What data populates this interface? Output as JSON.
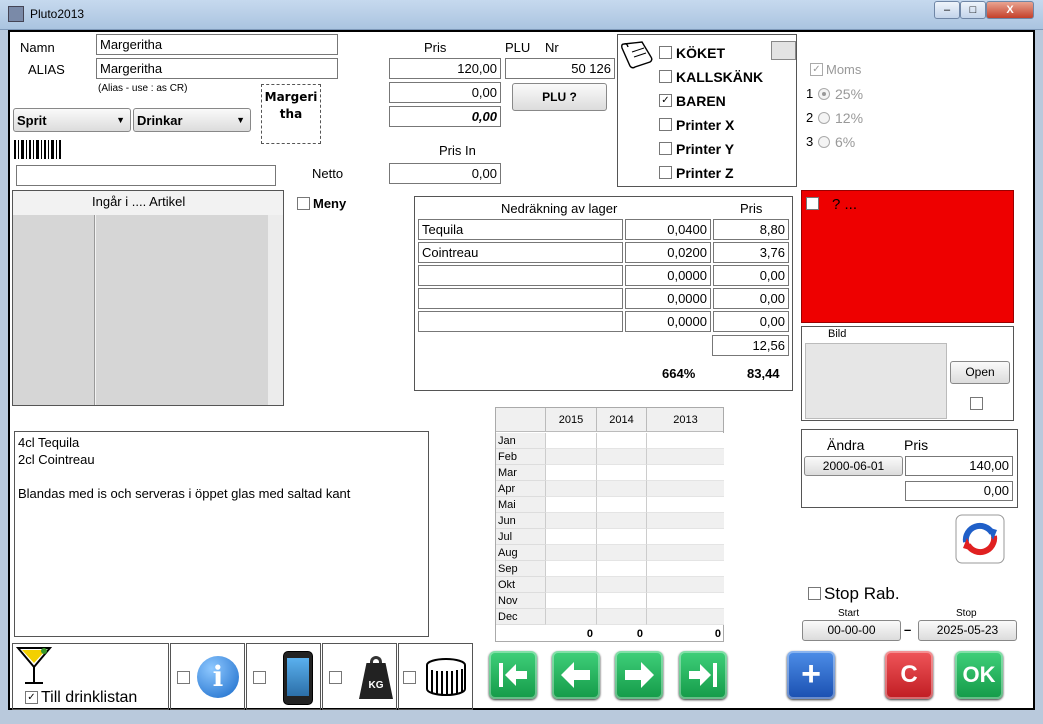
{
  "window": {
    "title": "Pluto2013",
    "minimize": "–",
    "maximize": "□",
    "close": "X"
  },
  "article": {
    "namn_label": "Namn",
    "namn_value": "Margeritha",
    "alias_label": "ALIAS",
    "alias_value": "Margeritha",
    "alias_hint": "(Alias - use : as CR)",
    "button_label_line1": "Margeri",
    "button_label_line2": "tha",
    "category1": "Sprit",
    "category2": "Drinkar",
    "barcode_value": ""
  },
  "pricing": {
    "pris_label": "Pris",
    "plu_label": "PLU",
    "nr_label": "Nr",
    "pris_value": "120,00",
    "plu_value": "50 126",
    "pris2": "0,00",
    "pris3": "0,00",
    "plu_button": "PLU ?",
    "pris_in_label": "Pris In",
    "netto_label": "Netto",
    "netto_value": "0,00"
  },
  "printers": [
    {
      "label": "KÖKET",
      "checked": false
    },
    {
      "label": "KALLSKÄNK",
      "checked": false
    },
    {
      "label": "BAREN",
      "checked": true
    },
    {
      "label": "Printer X",
      "checked": false
    },
    {
      "label": "Printer Y",
      "checked": false
    },
    {
      "label": "Printer Z",
      "checked": false
    }
  ],
  "moms": {
    "label": "Moms",
    "options": [
      {
        "num": "1",
        "rate": "25%",
        "selected": true
      },
      {
        "num": "2",
        "rate": "12%",
        "selected": false
      },
      {
        "num": "3",
        "rate": "6%",
        "selected": false
      }
    ]
  },
  "ingar": {
    "header": "Ingår i ....  Artikel",
    "meny_label": "Meny"
  },
  "lager": {
    "title": "Nedräkning av lager",
    "pris_header": "Pris",
    "rows": [
      {
        "name": "Tequila",
        "qty": "0,0400",
        "price": "8,80"
      },
      {
        "name": "Cointreau",
        "qty": "0,0200",
        "price": "3,76"
      },
      {
        "name": "",
        "qty": "0,0000",
        "price": "0,00"
      },
      {
        "name": "",
        "qty": "0,0000",
        "price": "0,00"
      },
      {
        "name": "",
        "qty": "0,0000",
        "price": "0,00"
      }
    ],
    "subtotal": "12,56",
    "percent": "664%",
    "total": "83,44"
  },
  "redbox": {
    "text": "? ..."
  },
  "bild": {
    "label": "Bild",
    "open_button": "Open"
  },
  "description": {
    "lines": [
      "4cl Tequila",
      "2cl Cointreau",
      "",
      "Blandas med is och serveras i öppet glas med saltad kant"
    ]
  },
  "sales": {
    "years": [
      "2015",
      "2014",
      "2013"
    ],
    "months": [
      "Jan",
      "Feb",
      "Mar",
      "Apr",
      "Mai",
      "Jun",
      "Jul",
      "Aug",
      "Sep",
      "Okt",
      "Nov",
      "Dec"
    ],
    "totals": [
      "0",
      "0",
      "0"
    ]
  },
  "andra": {
    "andra_label": "Ändra",
    "pris_label": "Pris",
    "date": "2000-06-01",
    "price": "140,00",
    "price2": "0,00"
  },
  "stoprab": {
    "label": "Stop Rab.",
    "start_label": "Start",
    "stop_label": "Stop",
    "start_value": "00-00-00",
    "dash": "–",
    "stop_value": "2025-05-23"
  },
  "bottom": {
    "drinklist_label": "Till drinklistan",
    "drinklist_checked": true,
    "kg_label": "KG",
    "first": "|←",
    "prev": "←",
    "next": "→",
    "last": "→|",
    "add": "+",
    "cancel": "C",
    "ok": "OK"
  },
  "colors": {
    "red_panel": "#ee0000",
    "nav_green": "#1aa852",
    "add_blue": "#1f62c4",
    "cancel_red": "#d8262a"
  }
}
